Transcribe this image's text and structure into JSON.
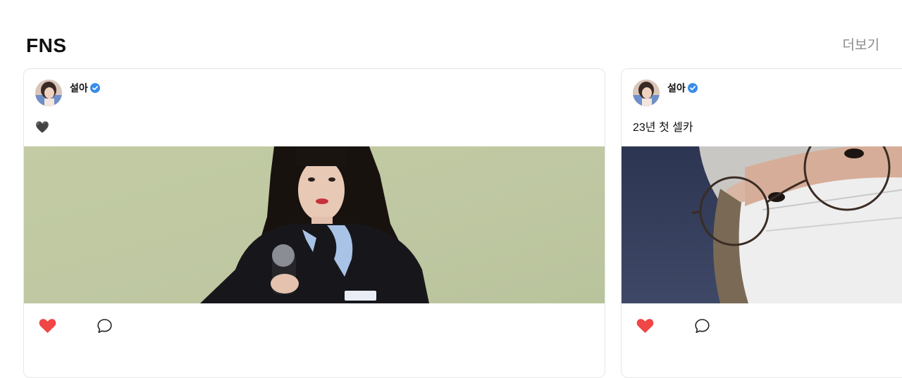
{
  "section": {
    "title": "FNS",
    "more_label": "더보기"
  },
  "posts": [
    {
      "author": "설아",
      "verified": true,
      "text": "🖤",
      "like_icon": "heart-icon",
      "comment_icon": "comment-icon",
      "liked": true
    },
    {
      "author": "설아",
      "verified": true,
      "text": "23년 첫 셀카",
      "like_icon": "heart-icon",
      "comment_icon": "comment-icon",
      "liked": true
    }
  ],
  "colors": {
    "like": "#f04646",
    "verified": "#3a8de8",
    "more_text": "#8a8a8a",
    "card_border": "#e6e6e6"
  }
}
